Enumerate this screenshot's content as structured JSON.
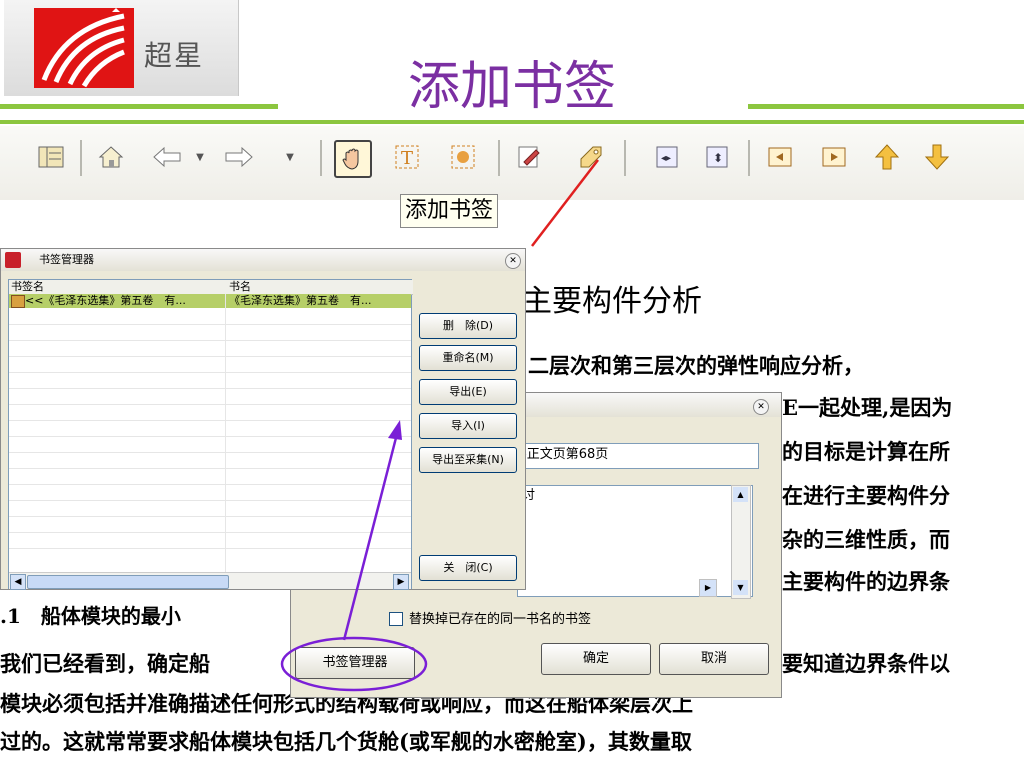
{
  "header": {
    "brand_text": "超星",
    "title": "添加书签"
  },
  "toolbar": {
    "icons": [
      "catalog-icon",
      "home-icon",
      "back-arrow-icon",
      "forward-arrow-icon",
      "hand-tool-icon",
      "text-select-icon",
      "image-select-icon",
      "note-icon",
      "add-bookmark-icon",
      "fit-width-icon",
      "fit-page-icon",
      "prev-page-icon",
      "next-page-icon",
      "up-arrow-icon",
      "down-arrow-icon"
    ],
    "tooltip": "添加书签"
  },
  "document": {
    "heading": "主要构件分析",
    "lines": [
      "二层次和第三层次的弹性响应分析，",
      "E一起处理,是因为",
      "的目标是计算在所",
      "在进行主要构件分",
      "杂的三维性质，而",
      "主要构件的边界条",
      ".1　船体模块的最小",
      "我们已经看到，确定船",
      "要知道边界条件以",
      "模块必须包括并准确描述任何形式的结构载荷或响应，而这在船体梁层次上",
      "过的。这就常常要求船体模块包括几个货舱(或军舰的水密舱室)，其数量取"
    ]
  },
  "bookmark_manager": {
    "title": "书签管理器",
    "columns": [
      "书签名",
      "书名"
    ],
    "rows": [
      {
        "bookmark": "<<《毛泽东选集》第五卷　有...",
        "book": "《毛泽东选集》第五卷　有..."
      }
    ],
    "buttons": {
      "delete": "删　除(D)",
      "rename": "重命名(M)",
      "export": "导出(E)",
      "import": "导入(I)",
      "export_collect": "导出至采集(N)",
      "close": "关　闭(C)"
    }
  },
  "add_bookmark_dialog": {
    "name_value": "-正文页第68页",
    "note_value": "讨",
    "replace_checkbox_label": "替换掉已存在的同一书名的书签",
    "replace_checked": false,
    "manager_button": "书签管理器",
    "ok_button": "确定",
    "cancel_button": "取消"
  },
  "annotation_colors": {
    "title": "#7b2fa2",
    "arrow_red": "#e02020",
    "arrow_purple": "#7a1fd6",
    "accent_green": "#8cc63f"
  }
}
